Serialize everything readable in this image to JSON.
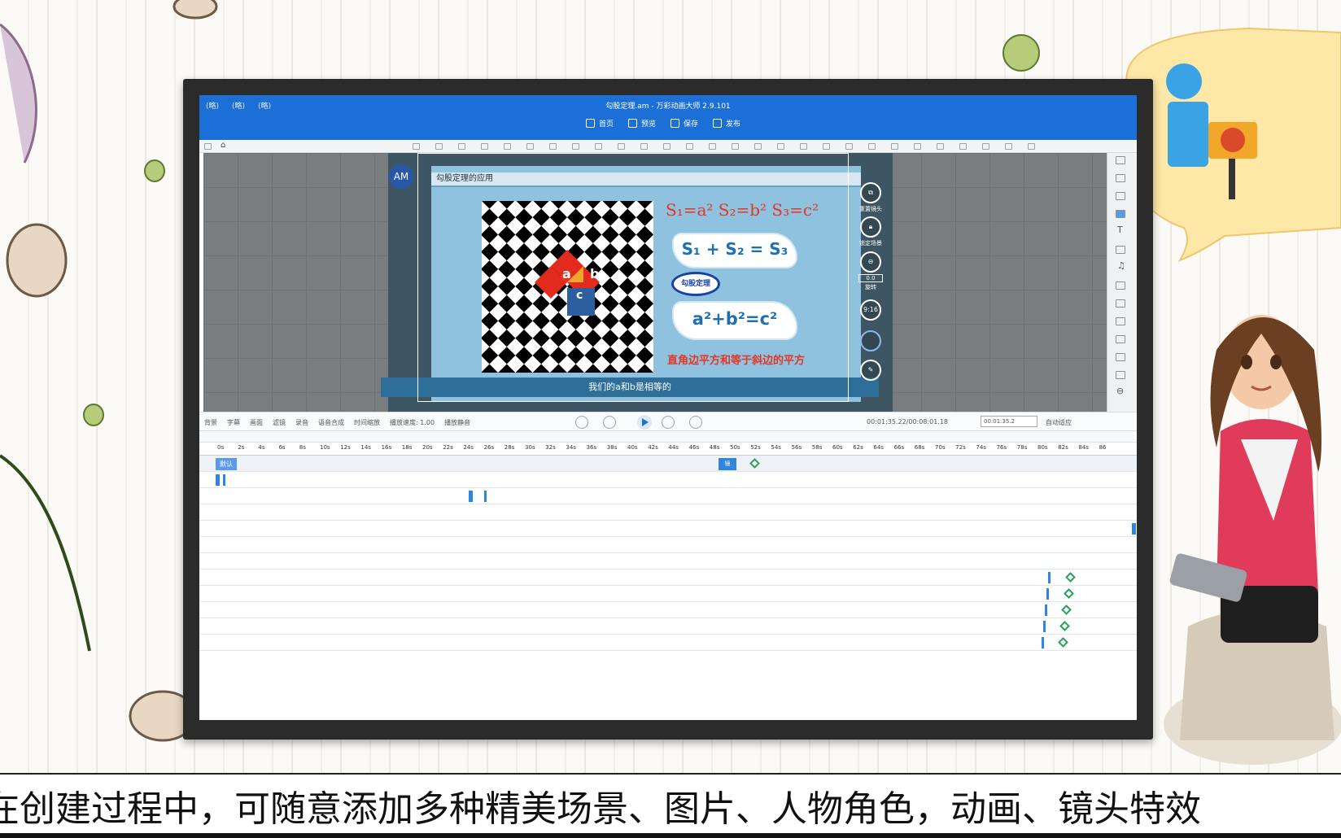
{
  "window": {
    "title": "勾股定理.am - 万彩动画大师 2.9.101",
    "menu": [
      "(略)",
      "(略)",
      "(略)"
    ]
  },
  "nav": {
    "home": "首页",
    "preview": "预览",
    "save": "保存",
    "publish": "发布"
  },
  "stage": {
    "avatar": "AM",
    "slide_title": "勾股定理的应用",
    "label_a": "a",
    "label_b": "b",
    "label_c": "c",
    "formula_top": "S₁=a²  S₂=b²  S₃=c²",
    "formula_sum": "S₁ + S₂ = S₃",
    "badge": "勾股定理",
    "formula_pyth": "a²+b²=c²",
    "red_caption": "直角边平方和等于斜边的平方",
    "subtitle": "我们的a和b是相等的"
  },
  "side_controls": {
    "reset_camera": "重置镜头",
    "lock_scene": "锁定场景",
    "rotate": "旋转",
    "rotate_value": "0.0",
    "ratio": "9:16"
  },
  "playerbar": {
    "tools": [
      "背景",
      "字幕",
      "画面",
      "滤镜",
      "录音",
      "语音合成",
      "时间缩放",
      "播放速度: 1.00",
      "播放静音"
    ],
    "timecode": "00:01:35.22/00:08:01.18",
    "time_input": "00:01:35.2",
    "autofit": "自动适应"
  },
  "timeline": {
    "ruler": [
      "0s",
      "2s",
      "4s",
      "6s",
      "8s",
      "10s",
      "12s",
      "14s",
      "16s",
      "18s",
      "20s",
      "22s",
      "24s",
      "26s",
      "28s",
      "30s",
      "32s",
      "34s",
      "36s",
      "38s",
      "40s",
      "42s",
      "44s",
      "46s",
      "48s",
      "50s",
      "52s",
      "54s",
      "56s",
      "58s",
      "60s",
      "62s",
      "64s",
      "66s",
      "68s",
      "70s",
      "72s",
      "74s",
      "76s",
      "78s",
      "80s",
      "82s",
      "84s",
      "86"
    ],
    "default_label": "默认",
    "scene_label": "镜"
  },
  "caption": {
    "text": "在创建过程中，可随意添加多种精美场景、图片、人物角色，动画、镜头特效"
  },
  "colors": {
    "titlebar": "#1d6fd8",
    "stage": "#8ec2de",
    "accent_red": "#e53525",
    "keyframe": "#2f86e0"
  }
}
